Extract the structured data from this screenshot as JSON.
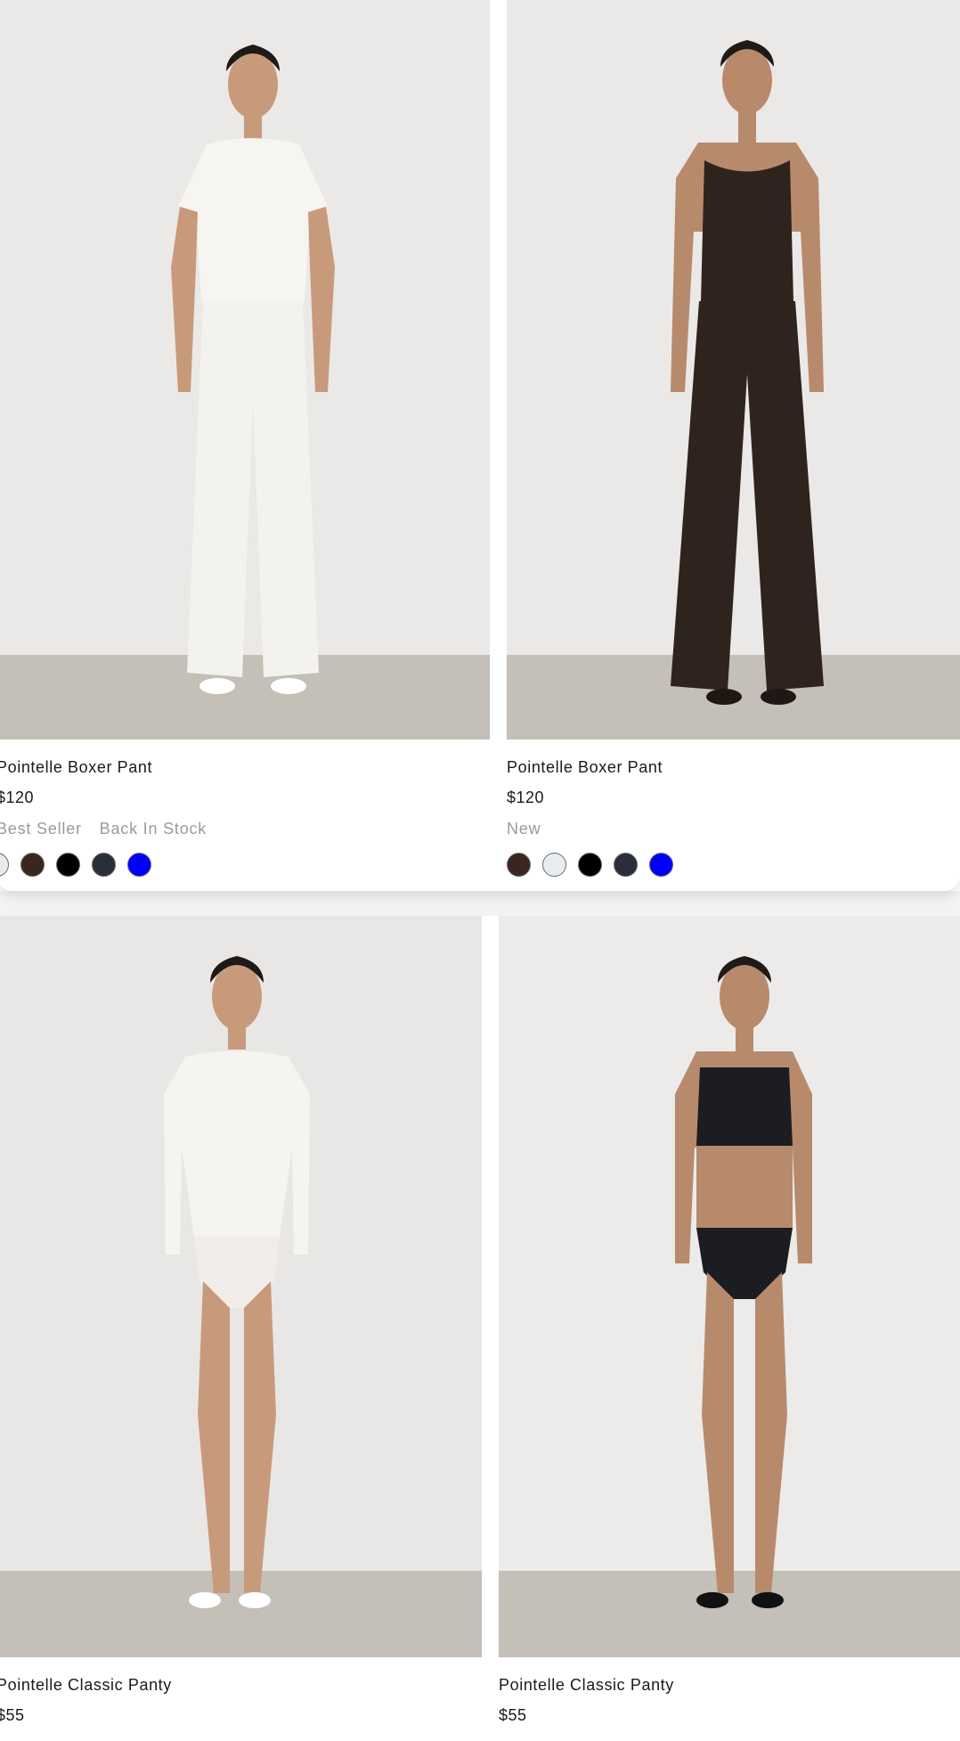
{
  "products": [
    {
      "title": "Pointelle Boxer Pant",
      "price": "$120",
      "tags": [
        "Best Seller",
        "Back In Stock"
      ],
      "swatches": [
        "#e9ecef",
        "#3a2621",
        "#000000",
        "#2a2d3a",
        "#0000ff"
      ],
      "outfit": "white-set"
    },
    {
      "title": "Pointelle Boxer Pant",
      "price": "$120",
      "tags": [
        "New"
      ],
      "swatches": [
        "#3a2621",
        "#e9ecef",
        "#000000",
        "#2a2d3a",
        "#0000ff"
      ],
      "outfit": "brown-set"
    },
    {
      "title": "Pointelle Classic Panty",
      "price": "$55",
      "tags": [],
      "swatches": [],
      "outfit": "white-longsleeve-panty"
    },
    {
      "title": "Pointelle Classic Panty",
      "price": "$55",
      "tags": [],
      "swatches": [],
      "outfit": "black-tank-panty"
    }
  ]
}
